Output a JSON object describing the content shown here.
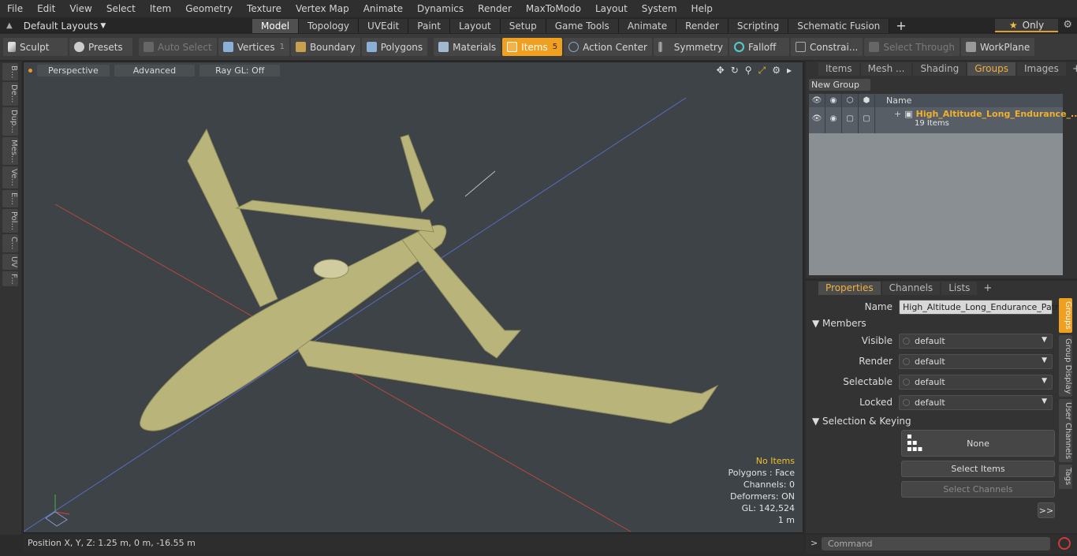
{
  "menu": [
    "File",
    "Edit",
    "View",
    "Select",
    "Item",
    "Geometry",
    "Texture",
    "Vertex Map",
    "Animate",
    "Dynamics",
    "Render",
    "MaxToModo",
    "Layout",
    "System",
    "Help"
  ],
  "layouts_label": "Default Layouts",
  "tabs": [
    {
      "label": "Model",
      "active": true
    },
    {
      "label": "Topology"
    },
    {
      "label": "UVEdit"
    },
    {
      "label": "Paint"
    },
    {
      "label": "Layout"
    },
    {
      "label": "Setup"
    },
    {
      "label": "Game Tools"
    },
    {
      "label": "Animate"
    },
    {
      "label": "Render"
    },
    {
      "label": "Scripting"
    },
    {
      "label": "Schematic Fusion"
    }
  ],
  "only_label": "Only",
  "toolbar": {
    "sculpt": "Sculpt",
    "presets": "Presets",
    "auto_select": "Auto Select",
    "vertices": "Vertices",
    "vertices_count": "1",
    "boundary": "Boundary",
    "polygons": "Polygons",
    "materials": "Materials",
    "items": "Items",
    "items_count": "5",
    "action_center": "Action Center",
    "symmetry": "Symmetry",
    "falloff": "Falloff",
    "constraints": "Constrai...",
    "select_through": "Select Through",
    "workplane": "WorkPlane"
  },
  "left_tabs": [
    "B...",
    "De...",
    "Dup...",
    "Mes...",
    "Ve...",
    "E...",
    "Pol...",
    "C...",
    "UV",
    "F..."
  ],
  "viewport": {
    "perspective": "Perspective",
    "advanced": "Advanced",
    "raygl": "Ray GL: Off",
    "info": {
      "items": "No Items",
      "polygons": "Polygons : Face",
      "channels": "Channels: 0",
      "deformers": "Deformers: ON",
      "gl": "GL: 142,524",
      "scale": "1 m"
    }
  },
  "status": {
    "position": "Position X, Y, Z:   1.25 m, 0 m, -16.55 m"
  },
  "right_top": {
    "tabs": [
      {
        "label": "Items"
      },
      {
        "label": "Mesh ..."
      },
      {
        "label": "Shading"
      },
      {
        "label": "Groups",
        "active": true
      },
      {
        "label": "Images"
      }
    ],
    "new_group": "New Group",
    "col_name": "Name",
    "group_title": "High_Altitude_Long_Endurance_...",
    "group_sub": "19 Items"
  },
  "properties": {
    "tabs": [
      {
        "label": "Properties",
        "active": true
      },
      {
        "label": "Channels"
      },
      {
        "label": "Lists"
      }
    ],
    "name_label": "Name",
    "name_value": "High_Altitude_Long_Endurance_Patro",
    "members": "Members",
    "visible_label": "Visible",
    "visible_value": "default",
    "render_label": "Render",
    "render_value": "default",
    "selectable_label": "Selectable",
    "selectable_value": "default",
    "locked_label": "Locked",
    "locked_value": "default",
    "sel_keying": "Selection & Keying",
    "none": "None",
    "select_items": "Select Items",
    "select_channels": "Select Channels",
    "more": ">>"
  },
  "side_tabs": [
    {
      "label": "Groups",
      "active": true
    },
    {
      "label": "Group Display"
    },
    {
      "label": "User Channels"
    },
    {
      "label": "Tags"
    }
  ],
  "command": {
    "placeholder": "Command"
  },
  "colors": {
    "accent": "#f0a020",
    "aircraft": "#b8b47a",
    "viewport_bg": "#3d4347"
  }
}
